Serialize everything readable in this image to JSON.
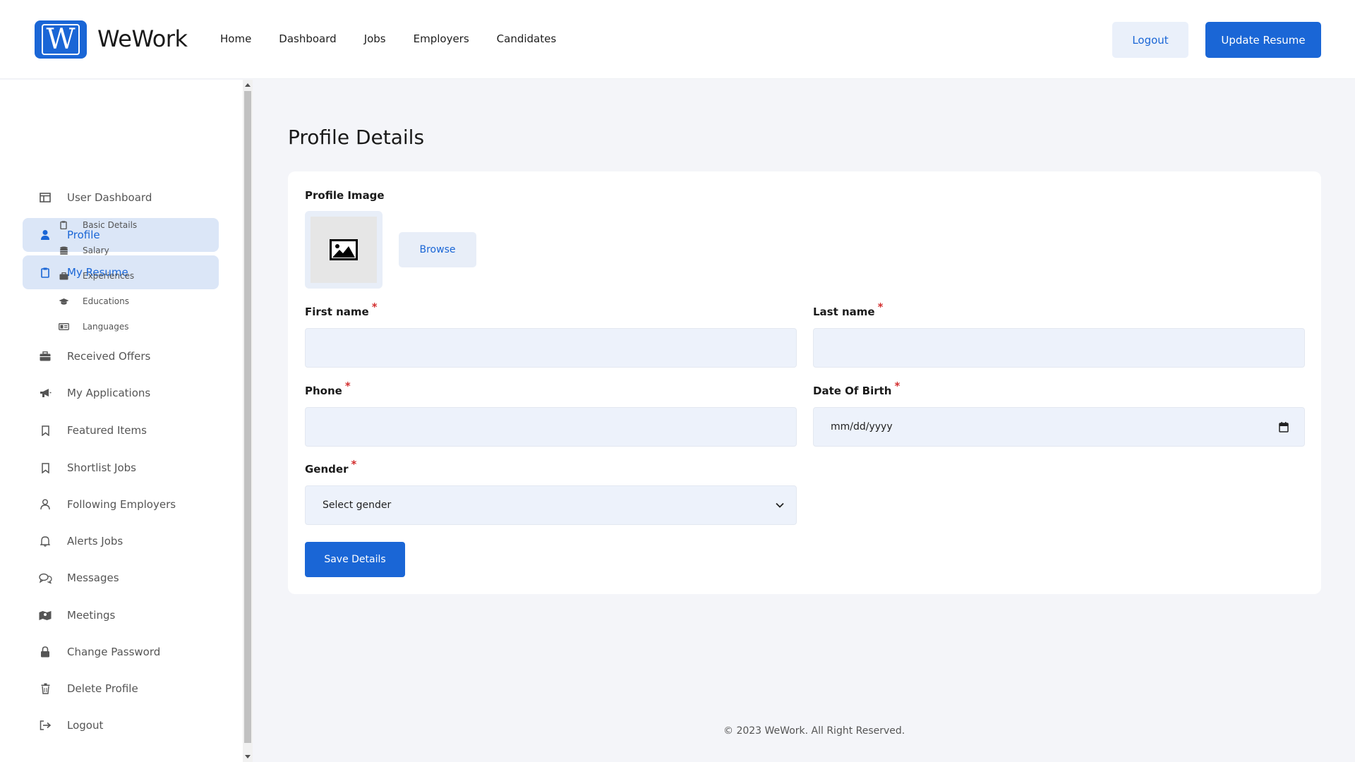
{
  "brand": {
    "logo_letter": "W",
    "name": "WeWork",
    "color": "#1a66d6"
  },
  "nav": [
    "Home",
    "Dashboard",
    "Jobs",
    "Employers",
    "Candidates"
  ],
  "header_buttons": {
    "logout": "Logout",
    "update_resume": "Update Resume"
  },
  "sidebar": {
    "items": [
      {
        "label": "User Dashboard",
        "icon": "dashboard-icon"
      },
      {
        "label": "Profile",
        "icon": "user-icon",
        "active": true
      },
      {
        "label": "My Resume",
        "icon": "clipboard-icon",
        "active": true
      }
    ],
    "sub_items": [
      {
        "label": "Basic Details",
        "icon": "clipboard-icon"
      },
      {
        "label": "Salary",
        "icon": "coins-icon"
      },
      {
        "label": "Experiences",
        "icon": "briefcase-icon"
      },
      {
        "label": "Educations",
        "icon": "graduation-cap-icon"
      },
      {
        "label": "Languages",
        "icon": "id-card-icon"
      }
    ],
    "more_items": [
      {
        "label": "Received Offers",
        "icon": "briefcase-icon"
      },
      {
        "label": "My Applications",
        "icon": "megaphone-icon"
      },
      {
        "label": "Featured Items",
        "icon": "bookmark-icon"
      },
      {
        "label": "Shortlist Jobs",
        "icon": "bookmark-icon"
      },
      {
        "label": "Following Employers",
        "icon": "person-icon"
      },
      {
        "label": "Alerts Jobs",
        "icon": "bell-icon"
      },
      {
        "label": "Messages",
        "icon": "chat-icon"
      },
      {
        "label": "Meetings",
        "icon": "map-icon"
      },
      {
        "label": "Change Password",
        "icon": "lock-icon"
      },
      {
        "label": "Delete Profile",
        "icon": "trash-icon"
      },
      {
        "label": "Logout",
        "icon": "sign-out-icon"
      }
    ]
  },
  "main": {
    "title": "Profile Details",
    "profile_image_label": "Profile Image",
    "browse_label": "Browse",
    "first_name_label": "First name",
    "last_name_label": "Last name",
    "phone_label": "Phone",
    "dob_label": "Date Of Birth",
    "dob_placeholder": "mm/dd/yyyy",
    "gender_label": "Gender",
    "gender_value": "Select gender",
    "required_mark": "*",
    "save_label": "Save Details"
  },
  "footer": "© 2023 WeWork. All Right Reserved."
}
